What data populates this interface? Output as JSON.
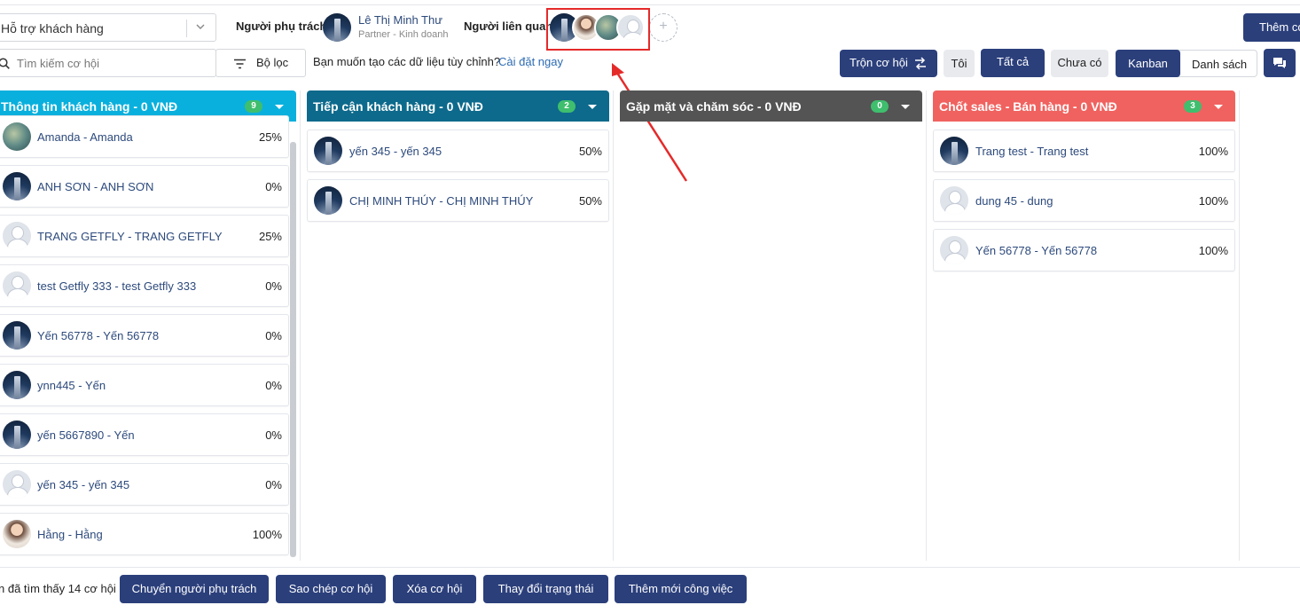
{
  "header": {
    "category_select": "Hỗ trợ khách hàng",
    "owner_label": "Người phụ trách",
    "owner_name": "Lê Thị Minh Thư",
    "owner_role": "Partner - Kinh doanh",
    "related_label": "Người liên quan",
    "add_related": "+",
    "add_button": "Thêm cơ"
  },
  "toolbar": {
    "search_placeholder": "Tìm kiếm cơ hội",
    "filter_label": "Bộ lọc",
    "custom_data_question": "Bạn muốn tạo các dữ liệu tùy chỉnh?",
    "custom_data_link": "Cài đặt ngay",
    "merge_label": "Trộn cơ hội",
    "me_label": "Tôi",
    "all_label": "Tất cả",
    "none_label": "Chưa có",
    "kanban_label": "Kanban",
    "list_label": "Danh sách"
  },
  "columns": [
    {
      "title": "Thông tin khách hàng - 0 VNĐ",
      "count": "9",
      "color": "#0ab0dd",
      "cards": [
        {
          "name": "Amanda - Amanda",
          "pct": "25%",
          "avatar": "teal"
        },
        {
          "name": "ANH SƠN - ANH SƠN",
          "pct": "0%",
          "avatar": "building"
        },
        {
          "name": "TRANG GETFLY - TRANG GETFLY",
          "pct": "25%",
          "avatar": "person"
        },
        {
          "name": "test Getfly 333 - test Getfly 333",
          "pct": "0%",
          "avatar": "person"
        },
        {
          "name": "Yến 56778 - Yến 56778",
          "pct": "0%",
          "avatar": "building"
        },
        {
          "name": "ynn445 - Yến",
          "pct": "0%",
          "avatar": "building"
        },
        {
          "name": "yến 5667890 - Yến",
          "pct": "0%",
          "avatar": "building"
        },
        {
          "name": "yến 345 - yến 345",
          "pct": "0%",
          "avatar": "person"
        },
        {
          "name": "Hằng - Hằng",
          "pct": "100%",
          "avatar": "photo"
        }
      ]
    },
    {
      "title": "Tiếp cận khách hàng - 0 VNĐ",
      "count": "2",
      "color": "#0d6a8c",
      "cards": [
        {
          "name": "yến 345 - yến 345",
          "pct": "50%",
          "avatar": "building"
        },
        {
          "name": "CHỊ MINH THÚY - CHỊ MINH THÚY",
          "pct": "50%",
          "avatar": "building"
        }
      ]
    },
    {
      "title": "Gặp mặt và chăm sóc - 0 VNĐ",
      "count": "0",
      "color": "#545454",
      "cards": []
    },
    {
      "title": "Chốt sales - Bán hàng - 0 VNĐ",
      "count": "3",
      "color": "#f0625f",
      "cards": [
        {
          "name": "Trang test - Trang test",
          "pct": "100%",
          "avatar": "building"
        },
        {
          "name": "dung 45 - dung",
          "pct": "100%",
          "avatar": "person"
        },
        {
          "name": "Yến 56778 - Yến 56778",
          "pct": "100%",
          "avatar": "person"
        }
      ]
    }
  ],
  "footer": {
    "found_text": "n đã tìm thấy 14 cơ hội",
    "actions": [
      "Chuyển người phụ trách",
      "Sao chép cơ hội",
      "Xóa cơ hội",
      "Thay đổi trạng thái",
      "Thêm mới công việc"
    ]
  },
  "colors": {
    "primary": "#2b3f7b",
    "annotation": "#e52a2a"
  }
}
